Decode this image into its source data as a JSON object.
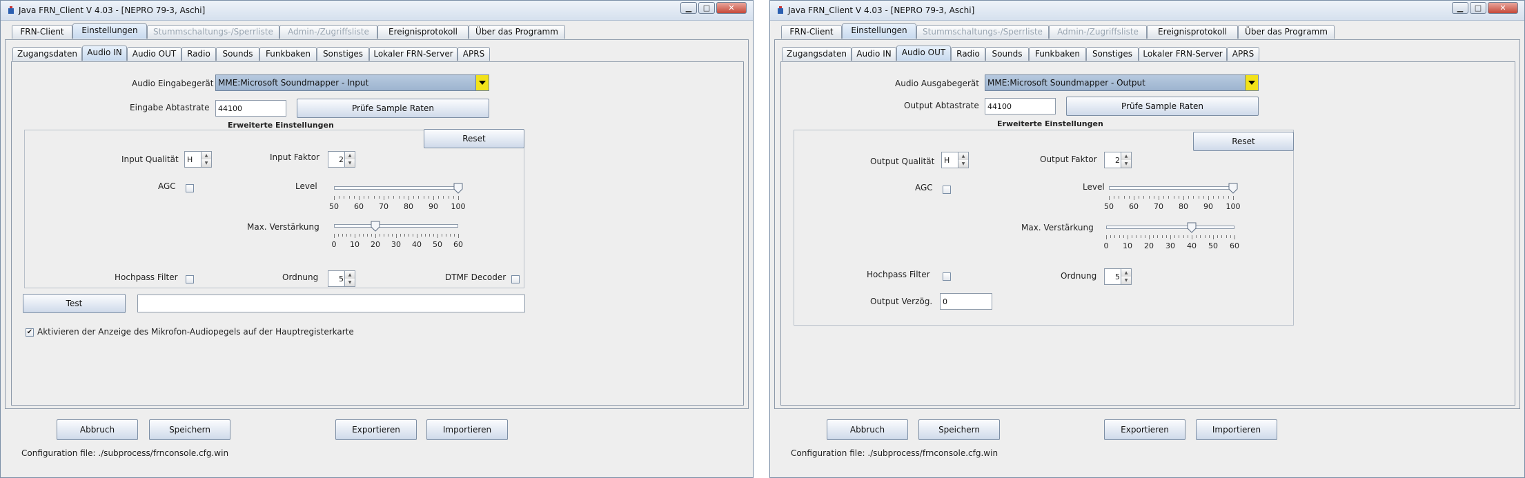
{
  "windows": [
    {
      "id": "left",
      "title": "Java FRN_Client V 4.03 - [NEPRO 79-3, Aschi]",
      "window_buttons": {
        "minimize": "▁",
        "maximize": "□",
        "close": "✕"
      },
      "main_tabs": [
        "FRN-Client",
        "Einstellungen",
        "Stummschaltungs-/Sperrliste",
        "Admin-/Zugriffsliste",
        "Ereignisprotokoll",
        "Über das Programm"
      ],
      "sub_tabs": [
        "Zugangsdaten",
        "Audio IN",
        "Audio OUT",
        "Radio",
        "Sounds",
        "Funkbaken",
        "Sonstiges",
        "Lokaler FRN-Server",
        "APRS"
      ],
      "device_label": "Audio Eingabegerät",
      "device_value": "MME:Microsoft Soundmapper - Input",
      "rate_label": "Eingabe Abtastrate",
      "rate_value": "44100",
      "check_rates_button": "Prüfe Sample Raten",
      "advanced_title": "Erweiterte Einstellungen",
      "reset_button": "Reset",
      "quality_label": "Input Qualität",
      "quality_value": "H",
      "factor_label": "Input Faktor",
      "factor_value": "2",
      "agc_label": "AGC",
      "level_label": "Level",
      "level_value": 100,
      "level_ticks": [
        "50",
        "60",
        "70",
        "80",
        "90",
        "100"
      ],
      "gain_label": "Max. Verstärkung",
      "gain_value": 20,
      "gain_ticks": [
        "0",
        "10",
        "20",
        "30",
        "40",
        "50",
        "60"
      ],
      "highpass_label": "Hochpass Filter",
      "order_label": "Ordnung",
      "order_value": "5",
      "dtmf_label": "DTMF Decoder",
      "test_button": "Test",
      "test_field": "",
      "show_level_checkbox_label": "Aktivieren der Anzeige des Mikrofon-Audiopegels auf der Hauptregisterkarte",
      "show_level_checked": "✔",
      "cancel_button": "Abbruch",
      "save_button": "Speichern",
      "export_button": "Exportieren",
      "import_button": "Importieren",
      "config_file": "Configuration file: ./subprocess/frnconsole.cfg.win"
    },
    {
      "id": "right",
      "title": "Java FRN_Client V 4.03 - [NEPRO 79-3, Aschi]",
      "window_buttons": {
        "minimize": "▁",
        "maximize": "□",
        "close": "✕"
      },
      "main_tabs": [
        "FRN-Client",
        "Einstellungen",
        "Stummschaltungs-/Sperrliste",
        "Admin-/Zugriffsliste",
        "Ereignisprotokoll",
        "Über das Programm"
      ],
      "sub_tabs": [
        "Zugangsdaten",
        "Audio IN",
        "Audio OUT",
        "Radio",
        "Sounds",
        "Funkbaken",
        "Sonstiges",
        "Lokaler FRN-Server",
        "APRS"
      ],
      "device_label": "Audio Ausgabegerät",
      "device_value": "MME:Microsoft Soundmapper - Output",
      "rate_label": "Output Abtastrate",
      "rate_value": "44100",
      "check_rates_button": "Prüfe Sample Raten",
      "advanced_title": "Erweiterte Einstellungen",
      "reset_button": "Reset",
      "quality_label": "Output Qualität",
      "quality_value": "H",
      "factor_label": "Output Faktor",
      "factor_value": "2",
      "agc_label": "AGC",
      "level_label": "Level",
      "level_value": 100,
      "level_ticks": [
        "50",
        "60",
        "70",
        "80",
        "90",
        "100"
      ],
      "gain_label": "Max. Verstärkung",
      "gain_value": 40,
      "gain_ticks": [
        "0",
        "10",
        "20",
        "30",
        "40",
        "50",
        "60"
      ],
      "highpass_label": "Hochpass Filter",
      "order_label": "Ordnung",
      "order_value": "5",
      "delay_label": "Output Verzög.",
      "delay_value": "0",
      "cancel_button": "Abbruch",
      "save_button": "Speichern",
      "export_button": "Exportieren",
      "import_button": "Importieren",
      "config_file": "Configuration file: ./subprocess/frnconsole.cfg.win"
    }
  ]
}
